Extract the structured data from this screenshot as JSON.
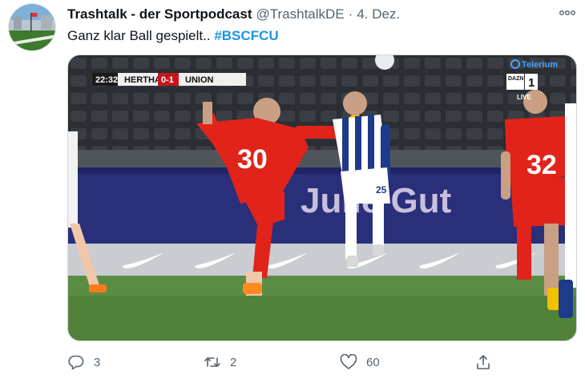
{
  "tweet": {
    "author_name": "Trashtalk - der Sportpodcast",
    "handle": "@TrashtalkDE",
    "separator": "·",
    "date": "4. Dez.",
    "text": "Ganz klar Ball gespielt.. ",
    "hashtag": "#BSCFCU",
    "more_icon": "more-dots-icon"
  },
  "media": {
    "scoreboard": {
      "time": "22:32",
      "home": "HERTHA",
      "score": "0-1",
      "away": "UNION"
    },
    "broadcaster": "Telerium",
    "channel": "DAZN",
    "channel_number": "1",
    "live_label": "LIVE",
    "players": {
      "left_number": "30",
      "right_number": "32",
      "blue_number": "25"
    },
    "colors": {
      "union_red": "#e2231a",
      "hertha_blue": "#1d3b8a",
      "pitch": "#5b8c43"
    }
  },
  "actions": {
    "reply_count": "3",
    "retweet_count": "2",
    "like_count": "60",
    "reply_icon": "reply-icon",
    "retweet_icon": "retweet-icon",
    "like_icon": "heart-icon",
    "share_icon": "share-icon"
  }
}
